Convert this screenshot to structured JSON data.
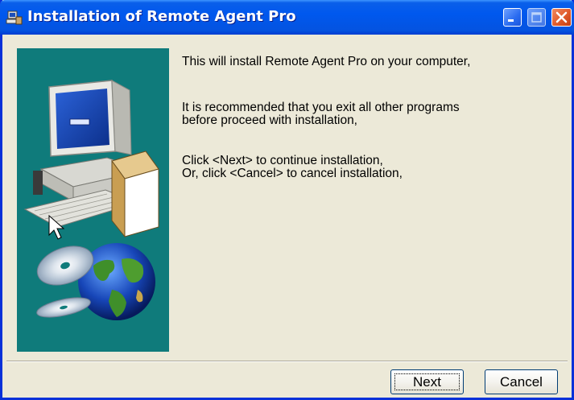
{
  "window": {
    "title": "Installation of Remote Agent Pro",
    "icon": "installer-icon"
  },
  "titlebar_buttons": {
    "minimize": "minimize-icon",
    "maximize": "maximize-icon",
    "close": "close-icon"
  },
  "side_panel": {
    "illustration": "computer-cd-globe-illustration",
    "background_color": "#0f7b7b"
  },
  "message": {
    "line1": "This will install Remote Agent Pro on your computer,",
    "line2": "It is recommended that you exit all other programs",
    "line3": "before proceed with installation,",
    "line4": "Click <Next> to continue installation,",
    "line5": "Or, click <Cancel> to cancel installation,"
  },
  "buttons": {
    "next_label": "Next",
    "cancel_label": "Cancel"
  },
  "colors": {
    "titlebar": "#0058ee",
    "dialog_background": "#ece9d8",
    "close_button": "#e05a2a"
  }
}
